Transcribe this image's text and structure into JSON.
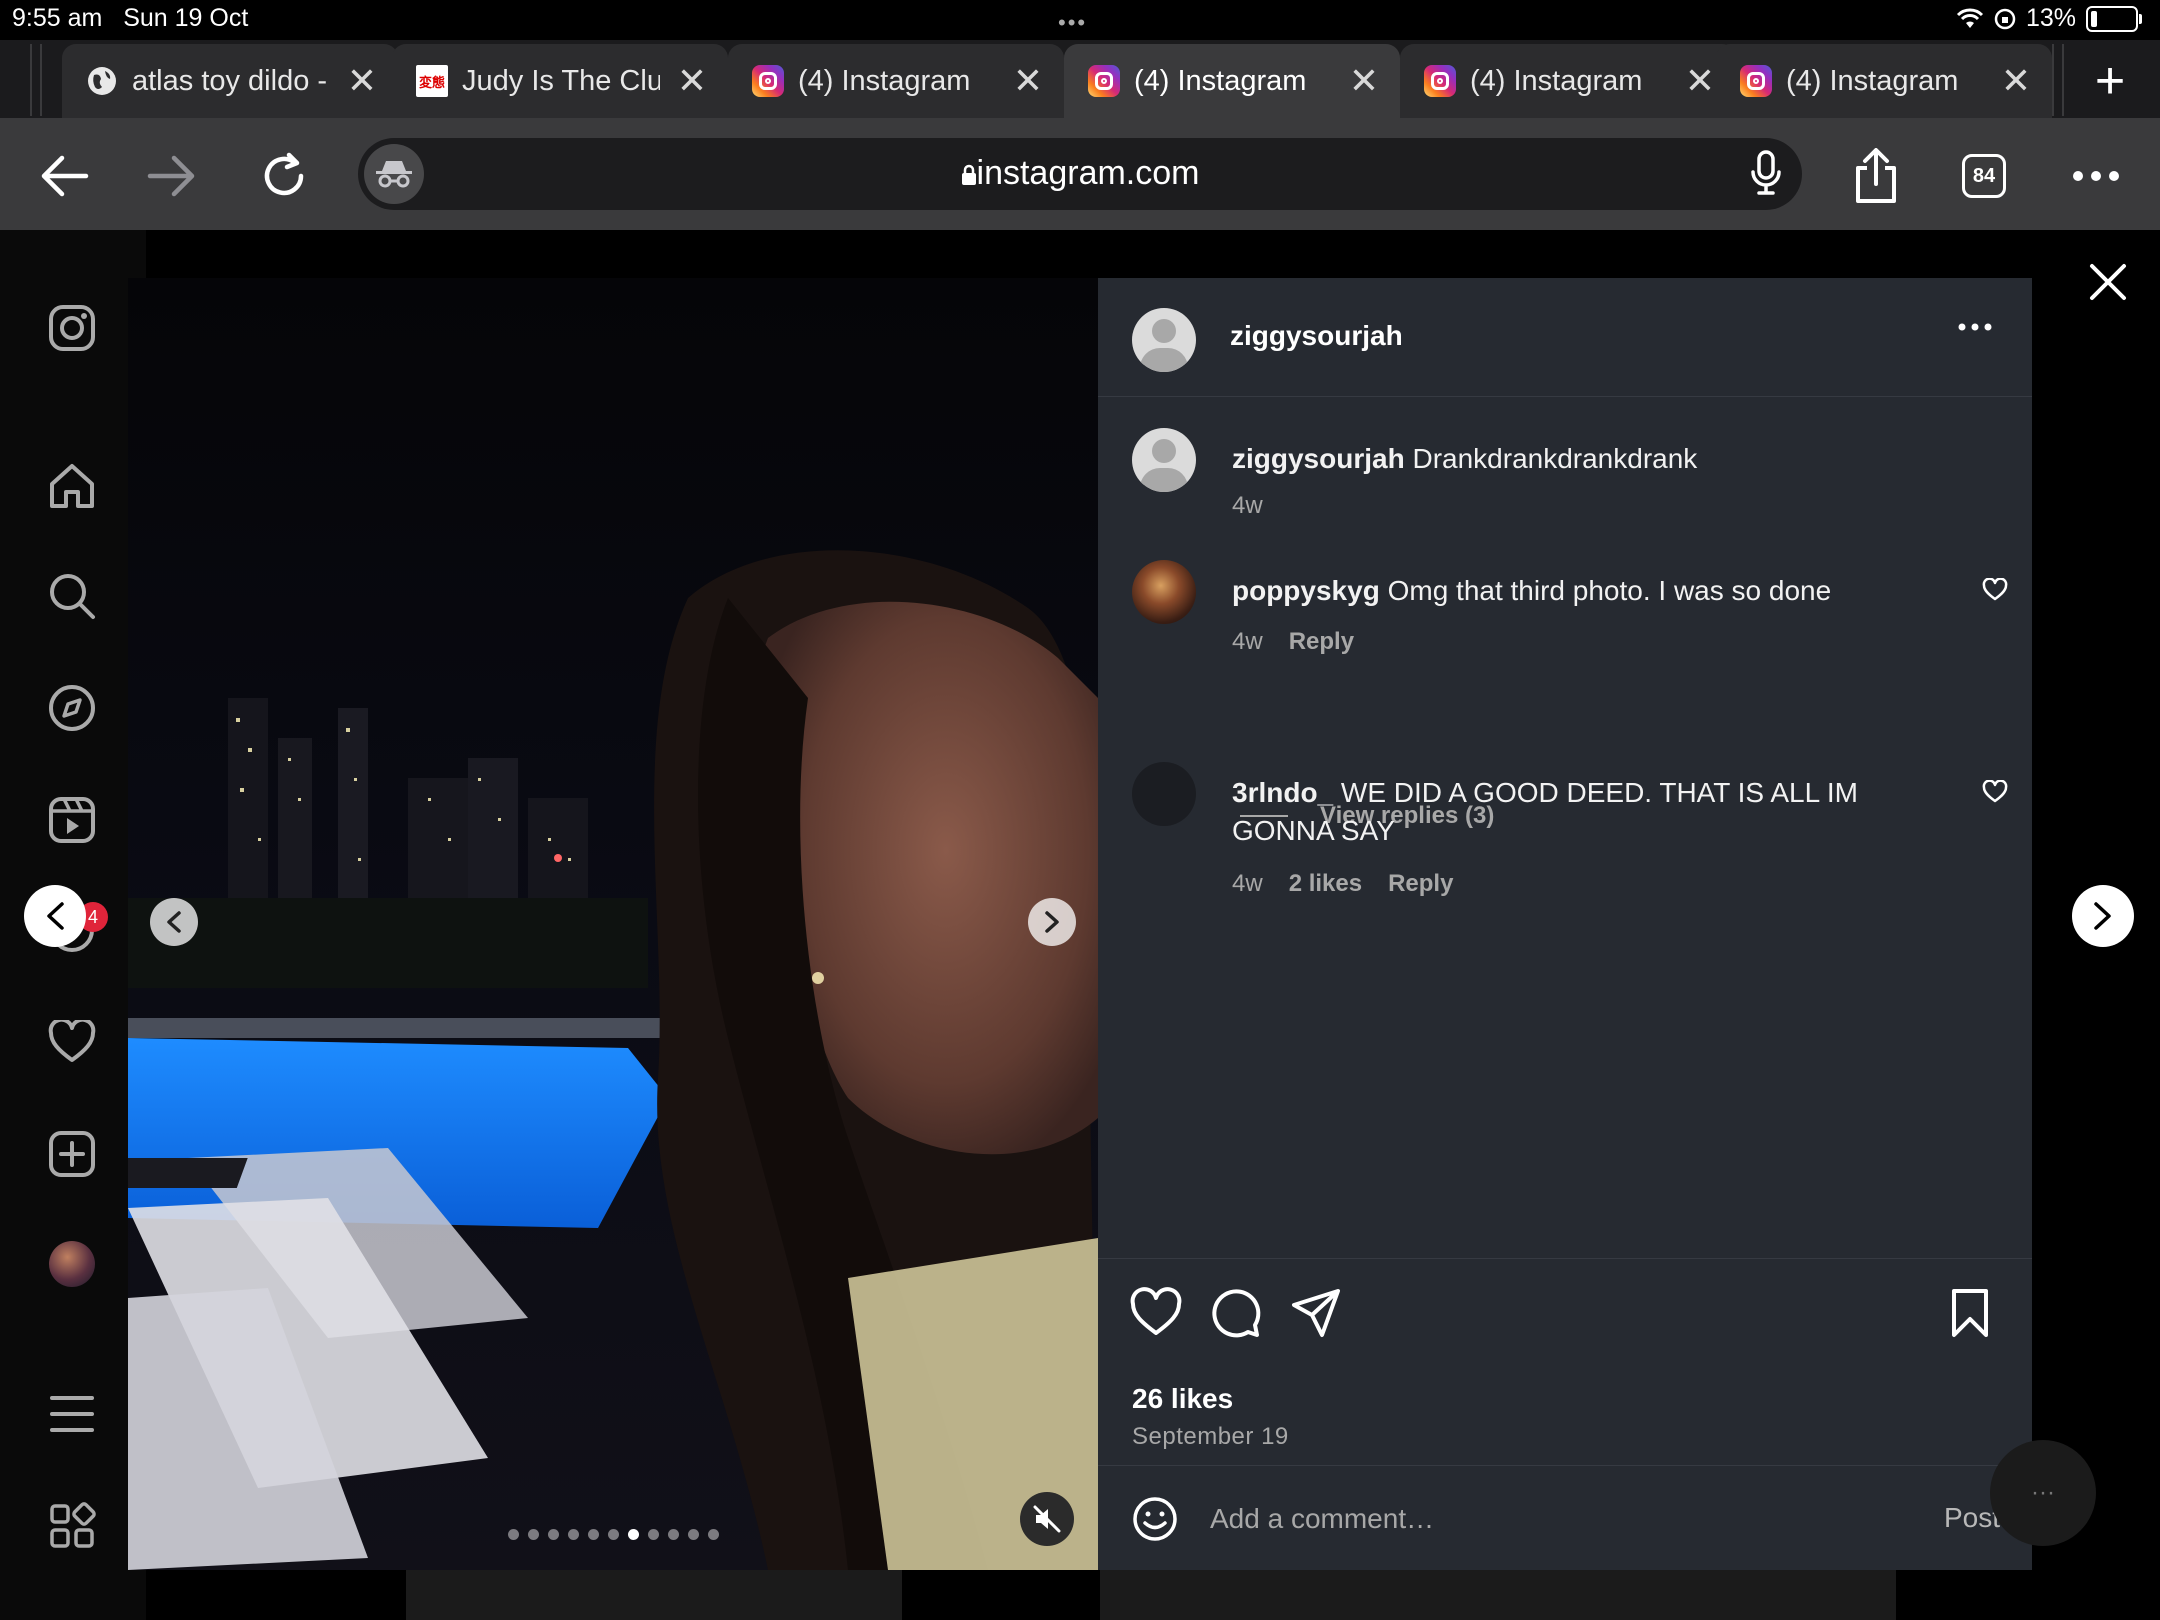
{
  "status": {
    "time": "9:55 am",
    "date": "Sun 19 Oct",
    "battery": "13%"
  },
  "tabs": [
    {
      "title": "atlas toy dildo -",
      "favicon": "globe-icon"
    },
    {
      "title": "Judy Is The Clu",
      "favicon": "judy-favicon",
      "favicon_text": "変態"
    },
    {
      "title": "(4) Instagram",
      "favicon": "instagram-icon"
    },
    {
      "title": "(4) Instagram",
      "favicon": "instagram-icon",
      "active": true
    },
    {
      "title": "(4) Instagram",
      "favicon": "instagram-icon"
    },
    {
      "title": "(4) Instagram",
      "favicon": "instagram-icon"
    }
  ],
  "new_tab_label": "+",
  "toolbar": {
    "url": "instagram.com",
    "tab_count": "84"
  },
  "post": {
    "username": "ziggysourjah",
    "carousel": {
      "total": 11,
      "current": 7
    },
    "comments": [
      {
        "user": "ziggysourjah",
        "text": "Drankdrankdrankdrank",
        "time": "4w"
      },
      {
        "user": "poppyskyg",
        "text": "Omg that third photo. I was so done",
        "time": "4w",
        "reply": "Reply",
        "view_replies": "View replies (3)"
      },
      {
        "user": "3rlndo_",
        "text": "WE DID A GOOD DEED. THAT IS ALL IM GONNA SAY",
        "time": "4w",
        "likes": "2 likes",
        "reply": "Reply"
      }
    ],
    "likes": "26 likes",
    "date": "September 19",
    "comment_placeholder": "Add a comment…",
    "post_label": "Post"
  },
  "left_nav_badge": "4",
  "colors": {
    "background": "#000000",
    "panel": "#262a31",
    "toolbar": "#3a3a3c",
    "badge": "#e0243a"
  }
}
